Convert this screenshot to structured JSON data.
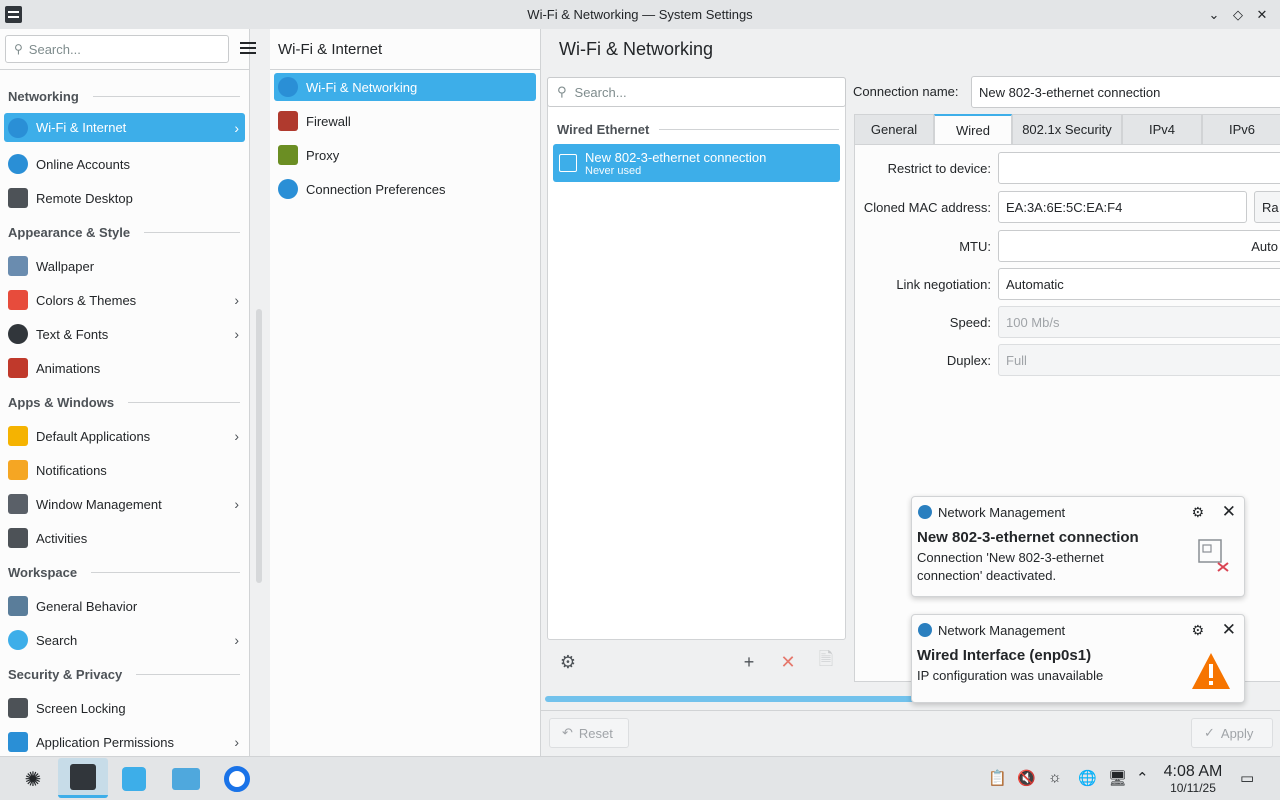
{
  "window": {
    "title": "Wi-Fi & Networking — System Settings"
  },
  "sidebar": {
    "search_placeholder": "Search...",
    "sections": [
      {
        "title": "Networking",
        "items": [
          {
            "label": "Wi-Fi & Internet",
            "icon": "globe-icon",
            "chevron": true,
            "active": true
          },
          {
            "label": "Online Accounts",
            "icon": "globe-icon",
            "chevron": false
          },
          {
            "label": "Remote Desktop",
            "icon": "monitor-icon",
            "chevron": false
          }
        ]
      },
      {
        "title": "Appearance & Style",
        "items": [
          {
            "label": "Wallpaper",
            "icon": "wallpaper-icon",
            "chevron": false
          },
          {
            "label": "Colors & Themes",
            "icon": "palette-icon",
            "chevron": true
          },
          {
            "label": "Text & Fonts",
            "icon": "font-icon",
            "chevron": true
          },
          {
            "label": "Animations",
            "icon": "animation-icon",
            "chevron": false
          }
        ]
      },
      {
        "title": "Apps & Windows",
        "items": [
          {
            "label": "Default Applications",
            "icon": "star-icon",
            "chevron": true
          },
          {
            "label": "Notifications",
            "icon": "bell-icon",
            "chevron": false
          },
          {
            "label": "Window Management",
            "icon": "window-icon",
            "chevron": true
          },
          {
            "label": "Activities",
            "icon": "activities-icon",
            "chevron": false
          }
        ]
      },
      {
        "title": "Workspace",
        "items": [
          {
            "label": "General Behavior",
            "icon": "behavior-icon",
            "chevron": false
          },
          {
            "label": "Search",
            "icon": "search-icon",
            "chevron": true
          }
        ]
      },
      {
        "title": "Security & Privacy",
        "items": [
          {
            "label": "Screen Locking",
            "icon": "lock-screen-icon",
            "chevron": false
          },
          {
            "label": "Application Permissions",
            "icon": "shield-icon",
            "chevron": true
          }
        ]
      }
    ]
  },
  "subnav": {
    "title": "Wi-Fi & Internet",
    "items": [
      {
        "label": "Wi-Fi & Networking",
        "icon": "globe-icon",
        "active": true
      },
      {
        "label": "Firewall",
        "icon": "firewall-icon"
      },
      {
        "label": "Proxy",
        "icon": "proxy-icon"
      },
      {
        "label": "Connection Preferences",
        "icon": "globe-icon"
      }
    ]
  },
  "main": {
    "title": "Wi-Fi & Networking",
    "search_placeholder": "Search...",
    "group": "Wired Ethernet",
    "connection": {
      "name": "New 802-3-ethernet connection",
      "status": "Never used"
    },
    "form": {
      "connection_name_label": "Connection name:",
      "connection_name_value": "New 802-3-ethernet connection",
      "tabs": [
        "General",
        "Wired",
        "802.1x Security",
        "IPv4",
        "IPv6"
      ],
      "active_tab": "Wired",
      "restrict_label": "Restrict to device:",
      "restrict_value": "",
      "mac_label": "Cloned MAC address:",
      "mac_value": "EA:3A:6E:5C:EA:F4",
      "mac_button": "Ra",
      "mtu_label": "MTU:",
      "mtu_value": "Auto",
      "link_label": "Link negotiation:",
      "link_value": "Automatic",
      "speed_label": "Speed:",
      "speed_value": "100 Mb/s",
      "duplex_label": "Duplex:",
      "duplex_value": "Full"
    },
    "reset_label": "Reset",
    "apply_label": "Apply"
  },
  "notifications": [
    {
      "app": "Network Management",
      "title": "New 802-3-ethernet connection",
      "body": "Connection 'New 802-3-ethernet connection' deactivated."
    },
    {
      "app": "Network Management",
      "title": "Wired Interface (enp0s1)",
      "body": "IP configuration was unavailable"
    }
  ],
  "taskbar": {
    "time": "4:08 AM",
    "date": "10/11/25"
  },
  "colors": {
    "accent": "#3daee9",
    "warning": "#f67400"
  }
}
